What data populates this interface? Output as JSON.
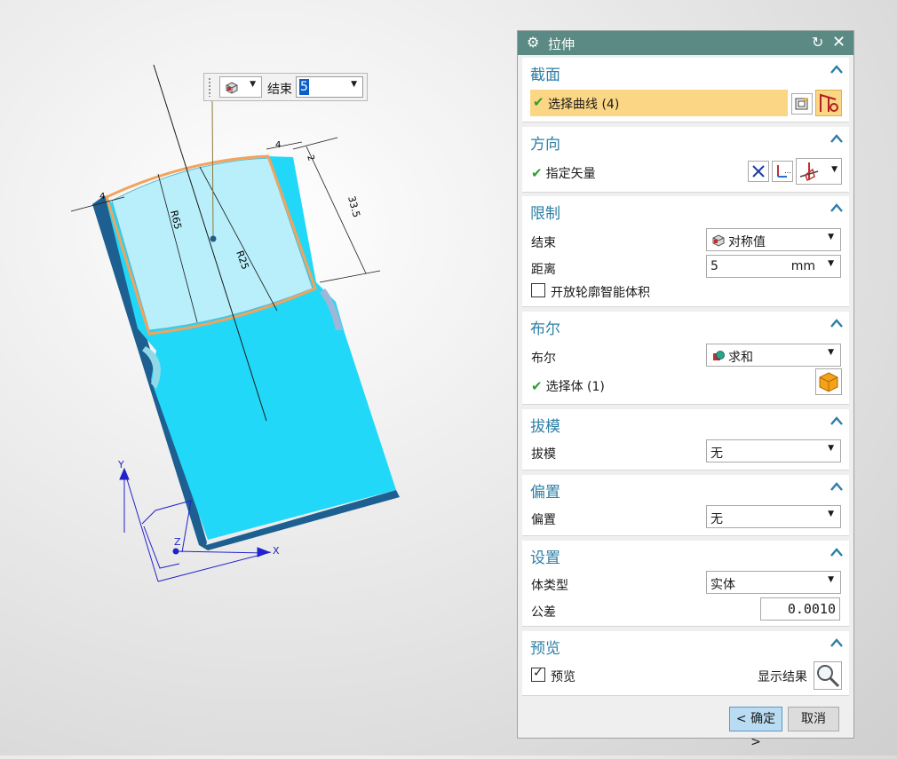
{
  "viewport": {
    "dims": {
      "d_4_top": "4",
      "d_2": "2",
      "d_33_5": "33.5",
      "d_4_left": "4",
      "d_r65": "R65",
      "d_r25": "R25"
    },
    "axes": {
      "x": "X",
      "y": "Y",
      "z": "Z"
    },
    "colors": {
      "body": "#22d8f8",
      "body_edge": "#1a6fa0",
      "face": "#b8effa",
      "section": "#f2a35c"
    }
  },
  "float_toolbar": {
    "label": "结束",
    "value": "5"
  },
  "dialog": {
    "title": "拉伸",
    "title_bar_color": "#5a8a83",
    "accent_color": "#2d7fa6",
    "section": {
      "header": "截面",
      "select_curve": "选择曲线 (4)"
    },
    "direction": {
      "header": "方向",
      "specify_vector": "指定矢量"
    },
    "limits": {
      "header": "限制",
      "end_label": "结束",
      "end_value": "对称值",
      "distance_label": "距离",
      "distance_value": "5",
      "distance_unit": "mm",
      "open_profile": "开放轮廓智能体积",
      "open_profile_checked": false
    },
    "boolean": {
      "header": "布尔",
      "label": "布尔",
      "value": "求和",
      "select_body": "选择体 (1)"
    },
    "draft": {
      "header": "拔模",
      "label": "拔模",
      "value": "无"
    },
    "offset": {
      "header": "偏置",
      "label": "偏置",
      "value": "无"
    },
    "settings": {
      "header": "设置",
      "body_type_label": "体类型",
      "body_type_value": "实体",
      "tolerance_label": "公差",
      "tolerance_value": "0.0010"
    },
    "preview": {
      "header": "预览",
      "preview_label": "预览",
      "preview_checked": true,
      "show_result": "显示结果"
    },
    "buttons": {
      "ok": "< 确定 >",
      "cancel": "取消"
    }
  }
}
